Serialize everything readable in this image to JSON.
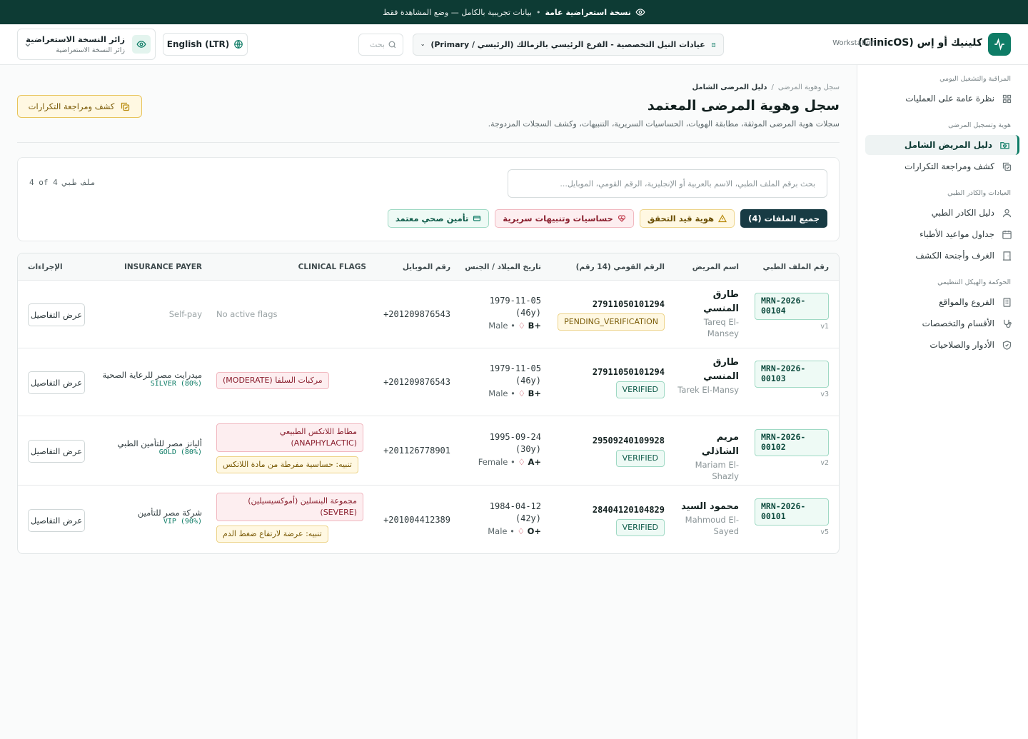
{
  "banner": {
    "bold": "نسخة استعراضية عامة",
    "text": "بيانات تجريبية بالكامل — وضع المشاهدة فقط"
  },
  "header": {
    "brand_name": "كلينيك أو إس (ClinicOS)",
    "brand_sub": "Workstation",
    "branch": "عيادات النيل التخصصية - الفرع الرئيسي بالزمالك (الرئيسي / Primary)",
    "search_placeholder": "بحث",
    "language": "English (LTR)",
    "user_name": "زائر النسخة الاستعراضية",
    "user_role": "زائر النسخة الاستعراضية"
  },
  "sidebar": {
    "sections": [
      {
        "title": "المراقبة والتشغيل اليومي",
        "items": [
          {
            "label": "نظرة عامة على العمليات",
            "icon": "grid-icon"
          }
        ]
      },
      {
        "title": "هوية وتسجيل المرضى",
        "items": [
          {
            "label": "دليل المريض الشامل",
            "icon": "folder-heart-icon",
            "active": true
          },
          {
            "label": "كشف ومراجعة التكرارات",
            "icon": "copy-check-icon"
          }
        ]
      },
      {
        "title": "العيادات والكادر الطبي",
        "items": [
          {
            "label": "دليل الكادر الطبي",
            "icon": "user-icon"
          },
          {
            "label": "جداول مواعيد الأطباء",
            "icon": "calendar-icon"
          },
          {
            "label": "الغرف وأجنحة الكشف",
            "icon": "door-icon"
          }
        ]
      },
      {
        "title": "الحوكمة والهيكل التنظيمي",
        "items": [
          {
            "label": "الفروع والمواقع",
            "icon": "building-icon"
          },
          {
            "label": "الأقسام والتخصصات",
            "icon": "stethoscope-icon"
          },
          {
            "label": "الأدوار والصلاحيات",
            "icon": "shield-icon"
          }
        ]
      }
    ]
  },
  "page": {
    "breadcrumb_root": "سجل وهوية المرضى",
    "breadcrumb_current": "دليل المرضى الشامل",
    "title": "سجل وهوية المرضى المعتمد",
    "subtitle": "سجلات هوية المرضى الموثقة، مطابقة الهويات، الحساسيات السريرية، التنبيهات، وكشف السجلات المزدوجة.",
    "duplicates_button": "كشف ومراجعة التكرارات"
  },
  "filters": {
    "search_placeholder": "بحث برقم الملف الطبي، الاسم بالعربية أو الإنجليزية، الرقم القومي، الموبايل...",
    "count": "4 of 4 ملف طبي",
    "chips": {
      "all": "جميع الملفات (4)",
      "pending": "هوية قيد التحقق",
      "allergy": "حساسيات وتنبيهات سريرية",
      "insured": "تأمين صحي معتمد"
    }
  },
  "table": {
    "headers": {
      "mrn": "رقم الملف الطبي",
      "name": "اسم المريض",
      "national_id": "الرقم القومي (14 رقم)",
      "dob": "تاريخ الميلاد / الجنس",
      "mobile": "رقم الموبايل",
      "flags": "CLINICAL FLAGS",
      "insurance": "INSURANCE PAYER",
      "actions": "الإجراءات"
    },
    "action_label": "عرض التفاصيل",
    "no_flags": "No active flags",
    "rows": [
      {
        "mrn": "MRN-2026-00104",
        "version": "v1",
        "name_ar": "طارق المنسي",
        "name_en": "Tareq El-Mansey",
        "national_id": "27911050101294",
        "status": "PENDING_VERIFICATION",
        "dob": "1979-11-05",
        "age": "(46y)",
        "blood": "B+",
        "gender": "Male",
        "mobile": "+201209876543",
        "insurance_name": "",
        "insurance_tier": "",
        "self_pay": "Self-pay"
      },
      {
        "mrn": "MRN-2026-00103",
        "version": "v3",
        "name_ar": "طارق المنسي",
        "name_en": "Tarek El-Mansy",
        "national_id": "27911050101294",
        "status": "VERIFIED",
        "dob": "1979-11-05",
        "age": "(46y)",
        "blood": "B+",
        "gender": "Male",
        "mobile": "+201209876543",
        "flag_red": "مركبات السلفا (MODERATE)",
        "insurance_name": "ميدرايت مصر للرعاية الصحية",
        "insurance_tier": "SILVER (80%)"
      },
      {
        "mrn": "MRN-2026-00102",
        "version": "v2",
        "name_ar": "مريم الشاذلي",
        "name_en": "Mariam El-Shazly",
        "national_id": "29509240109928",
        "status": "VERIFIED",
        "dob": "1995-09-24",
        "age": "(30y)",
        "blood": "A+",
        "gender": "Female",
        "mobile": "+201126778901",
        "flag_red": "مطاط اللاتكس الطبيعي (ANAPHYLACTIC)",
        "flag_yellow": "تنبيه: حساسية مفرطة من مادة اللاتكس",
        "insurance_name": "أليانز مصر للتأمين الطبي",
        "insurance_tier": "GOLD (80%)"
      },
      {
        "mrn": "MRN-2026-00101",
        "version": "v5",
        "name_ar": "محمود السيد",
        "name_en": "Mahmoud El-Sayed",
        "national_id": "28404120104829",
        "status": "VERIFIED",
        "dob": "1984-04-12",
        "age": "(42y)",
        "blood": "O+",
        "gender": "Male",
        "mobile": "+201004412389",
        "flag_red": "مجموعة البنسلين (أموكسيسيلين) (SEVERE)",
        "flag_yellow": "تنبيه: عرضة لارتفاع ضغط الدم",
        "insurance_name": "شركة مصر للتأمين",
        "insurance_tier": "VIP (90%)"
      }
    ]
  }
}
